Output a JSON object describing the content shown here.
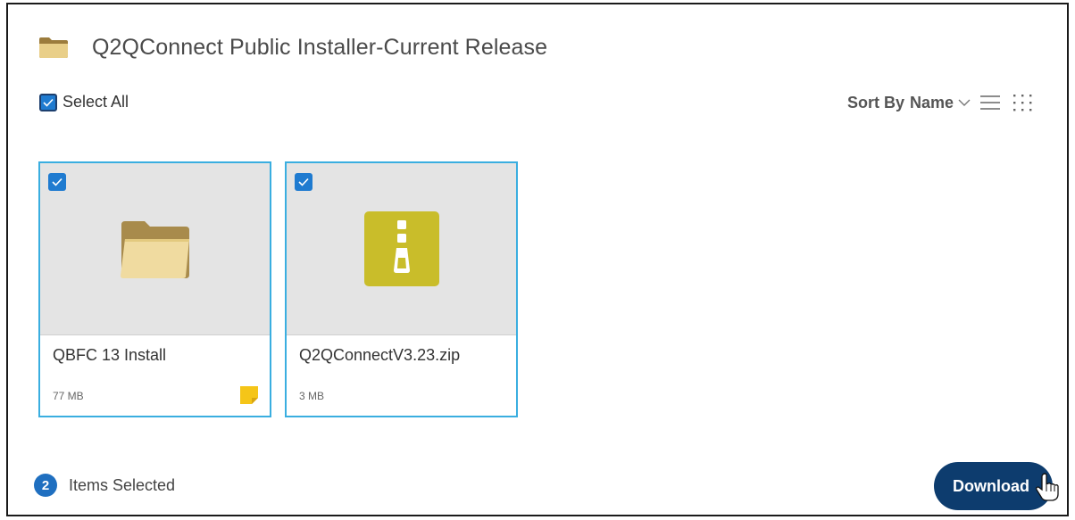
{
  "header": {
    "title": "Q2QConnect Public Installer-Current Release",
    "icon": "folder-icon"
  },
  "toolbar": {
    "select_all_label": "Select All",
    "select_all_checked": true,
    "sort_label": "Sort By",
    "sort_value": "Name",
    "list_view_icon": "list-view-icon",
    "grid_view_icon": "grid-view-icon"
  },
  "items": [
    {
      "name": "QBFC 13 Install",
      "size": "77 MB",
      "type": "folder",
      "icon": "folder-icon",
      "selected": true,
      "has_note": true,
      "note_icon": "note-icon"
    },
    {
      "name": "Q2QConnectV3.23.zip",
      "size": "3 MB",
      "type": "zip",
      "icon": "zip-file-icon",
      "selected": true,
      "has_note": false
    }
  ],
  "footer": {
    "selected_count": "2",
    "selected_label": "Items Selected",
    "download_label": "Download"
  },
  "colors": {
    "accent": "#1f7bd0",
    "card_border": "#3aaee0",
    "download_bg": "#0d3c6e",
    "folder": "#e8cf8c",
    "zip": "#c9bd2a",
    "note": "#f5c518"
  }
}
